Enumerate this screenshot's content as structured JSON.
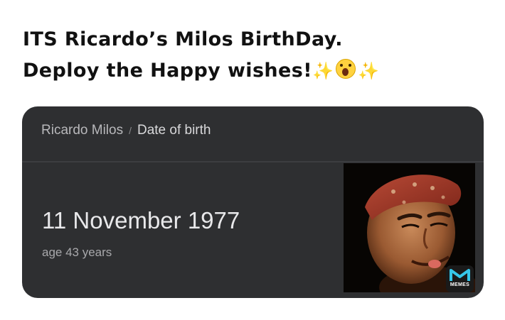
{
  "caption": {
    "line1": "ITS Ricardo’s Milos BirthDay.",
    "line2": "Deploy the Happy wishes!",
    "emojis": [
      "sparkles-emoji",
      "face-screaming-emoji",
      "sparkles-emoji"
    ]
  },
  "card": {
    "breadcrumb": {
      "entity": "Ricardo Milos",
      "separator": "/",
      "attribute": "Date of birth"
    },
    "answer": "11 November 1977",
    "subtext": "age 43 years",
    "photo_icon": "person-photo",
    "watermark": "MEMES"
  },
  "colors": {
    "card_bg": "#2e2f31",
    "accent_bandana": "#a13a2c"
  }
}
